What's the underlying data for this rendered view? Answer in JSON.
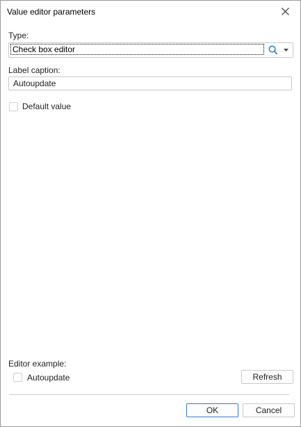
{
  "window": {
    "title": "Value editor parameters",
    "close_icon": "close-icon"
  },
  "type_field": {
    "label": "Type:",
    "value": "Check box editor",
    "search_icon": "search-icon",
    "dropdown_icon": "chevron-down-icon"
  },
  "caption_field": {
    "label": "Label caption:",
    "value": "Autoupdate"
  },
  "default_value": {
    "label": "Default value",
    "checked": false
  },
  "editor_example": {
    "label": "Editor example:",
    "checkbox_label": "Autoupdate",
    "checked": false,
    "refresh_label": "Refresh"
  },
  "footer": {
    "ok_label": "OK",
    "cancel_label": "Cancel"
  },
  "colors": {
    "accent": "#2e7bd6",
    "border": "#c8c8c8"
  }
}
